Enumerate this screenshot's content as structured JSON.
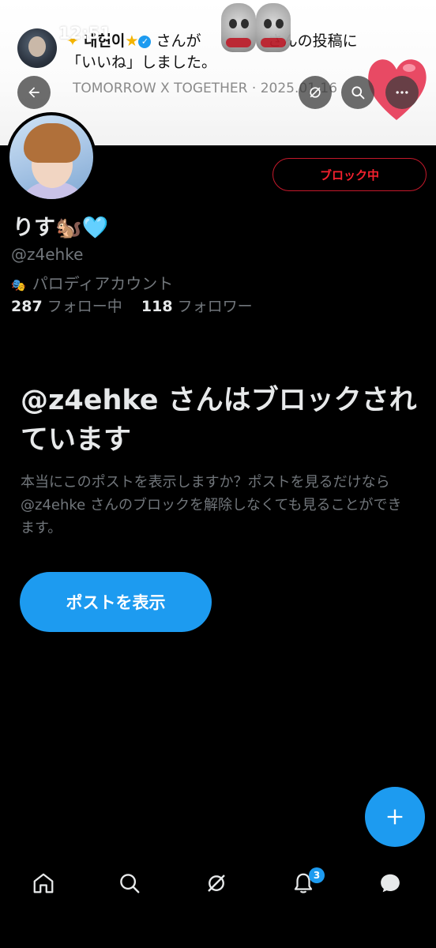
{
  "status_bar": {
    "time": "12:51"
  },
  "notification": {
    "user_name": "내현이",
    "line1_text": "さんが",
    "line1_tail": "さんの投稿に",
    "line2_text": "「いいね」しました。"
  },
  "header": {
    "breadcrumb": "TOMORROW X TOGETHER · 2025.01.16"
  },
  "profile": {
    "display_name": "りす🐿️🩵",
    "handle": "@z4ehke",
    "parody_label": "パロディアカウント",
    "following_count": "287",
    "following_label": "フォロー中",
    "followers_count": "118",
    "followers_label": "フォロワー",
    "block_button_label": "ブロック中"
  },
  "blocked_notice": {
    "title": "@z4ehke さんはブロックされています",
    "description": "本当にこのポストを表示しますか？ポストを見るだけなら @z4ehke さんのブロックを解除しなくても見ることができます。",
    "button_label": "ポストを表示"
  },
  "nav": {
    "notifications_badge": "3",
    "items": [
      "home-icon",
      "search-icon",
      "grok-icon",
      "notifications-icon",
      "messages-icon"
    ]
  },
  "colors": {
    "accent": "#1d9bf0",
    "block_red": "#f4212e",
    "muted_text": "#71767b"
  }
}
